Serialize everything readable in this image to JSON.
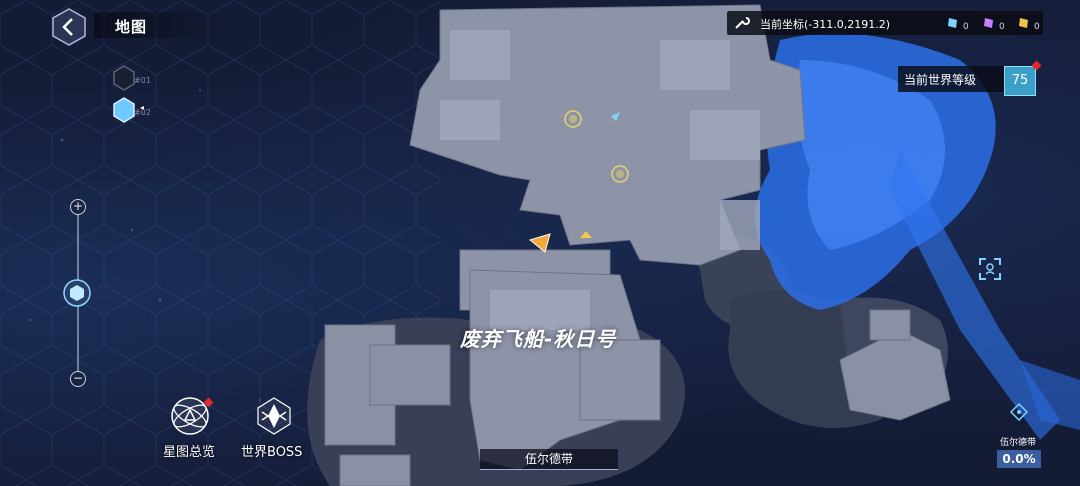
{
  "header": {
    "title": "地图"
  },
  "floors": [
    {
      "label": "#01",
      "active": false
    },
    {
      "label": "#02",
      "active": true
    }
  ],
  "zoom": {
    "plus": "+",
    "minus": "−",
    "level": 0.45
  },
  "coords": {
    "text": "当前坐标(-311.0,2191.2)"
  },
  "items": [
    {
      "name": "blue-crystal-icon",
      "count": "0",
      "color": "#7fd4ff"
    },
    {
      "name": "purple-crystal-icon",
      "count": "0",
      "color": "#c77dff"
    },
    {
      "name": "gold-crystal-icon",
      "count": "0",
      "color": "#f2c14e"
    }
  ],
  "world_level": {
    "label": "当前世界等级",
    "value": "75"
  },
  "map": {
    "region_name": "废弃飞船-秋日号",
    "area_name": "伍尔德带"
  },
  "buttons": {
    "star_map": "星图总览",
    "world_boss": "世界BOSS"
  },
  "exploration": {
    "title": "伍尔德带",
    "percent": "0.0%"
  },
  "colors": {
    "accent": "#3aa0c8",
    "crystal_blue": "#2f7bff",
    "alert": "#e0282e",
    "marker": "#f3a73a"
  }
}
